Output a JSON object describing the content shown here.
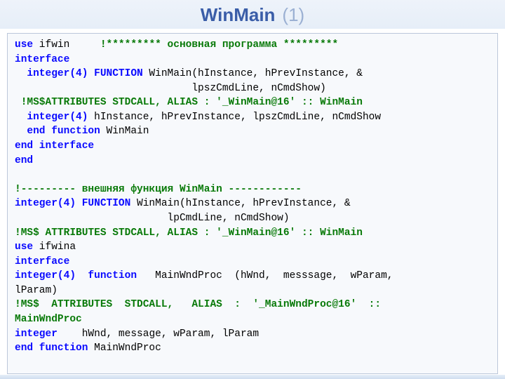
{
  "header": {
    "title_main": "WinMain",
    "title_num": "(1)"
  },
  "code": {
    "l1_a": "use",
    "l1_b": " ifwin     ",
    "l1_c": "!********* основная программа *********",
    "l2_a": "interface",
    "l3_a": "  integer(4) FUNCTION",
    "l3_b": " WinMain(hInstance, hPrevInstance, &",
    "l4_a": "                             lpszCmdLine, nCmdShow)",
    "l5_a": " !MS$ATTRIBUTES STDCALL, ALIAS : '_WinMain@16' :: WinMain",
    "l6_а": "  integer(4)",
    "l6_b": " hInstance, hPrevInstance, lpszCmdLine, nCmdShow",
    "l7_a": "  end function",
    "l7_b": " WinMain",
    "l8_a": "end interface",
    "l9_a": "end",
    "l10_a": "",
    "l11_a": "!--------- внешняя функция WinMain ------------",
    "l12_a": "integer(4) FUNCTION",
    "l12_b": " WinMain(hInstance, hPrevInstance, &",
    "l13_a": "                         lpCmdLine, nCmdShow)",
    "l14_a": "!MS$ ATTRIBUTES STDCALL, ALIAS : '_WinMain@16' :: WinMain",
    "l15_a": "use",
    "l15_b": " ifwina",
    "l16_a": "interface",
    "l17_a": "integer(4)  function",
    "l17_b": "   MainWndProc  (hWnd,  messsage,  wParam,",
    "l18_a": "lParam)",
    "l19_a": "!MS$  ATTRIBUTES  STDCALL,   ALIAS  :  '_MainWndProc@16'  ::",
    "l20_a": "MainWndProc",
    "l21_a": "integer",
    "l21_b": "    hWnd, message, wParam, lParam",
    "l22_a": "end function",
    "l22_b": " MainWndProc"
  }
}
